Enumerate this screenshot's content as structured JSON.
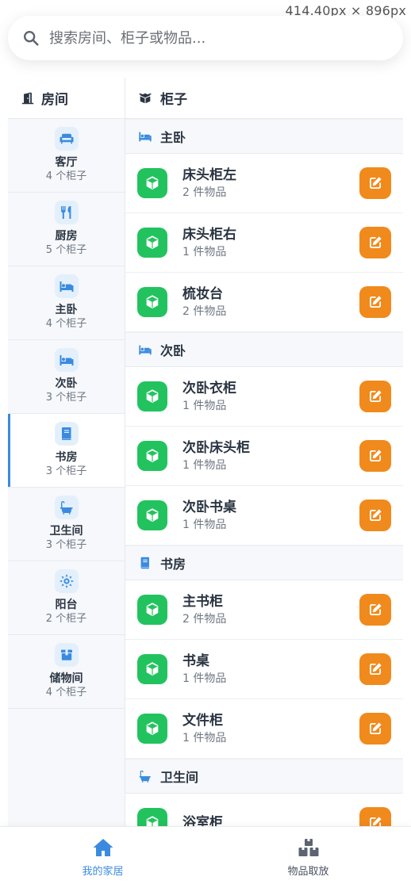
{
  "overlay": {
    "dimensions": "414.40px × 896px"
  },
  "search": {
    "placeholder": "搜索房间、柜子或物品..."
  },
  "sidebar": {
    "title": "房间",
    "rooms": [
      {
        "name": "客厅",
        "count": "4 个柜子",
        "icon": "sofa-icon"
      },
      {
        "name": "厨房",
        "count": "5 个柜子",
        "icon": "utensils-icon"
      },
      {
        "name": "主卧",
        "count": "4 个柜子",
        "icon": "bed-icon"
      },
      {
        "name": "次卧",
        "count": "3 个柜子",
        "icon": "bed-icon"
      },
      {
        "name": "书房",
        "count": "3 个柜子",
        "icon": "book-icon",
        "active": true
      },
      {
        "name": "卫生间",
        "count": "3 个柜子",
        "icon": "bath-icon"
      },
      {
        "name": "阳台",
        "count": "2 个柜子",
        "icon": "sun-icon"
      },
      {
        "name": "储物间",
        "count": "4 个柜子",
        "icon": "box-icon"
      }
    ]
  },
  "main": {
    "title": "柜子",
    "groups": [
      {
        "room": "主卧",
        "cabinets": [
          {
            "name": "床头柜左",
            "count": "2 件物品"
          },
          {
            "name": "床头柜右",
            "count": "1 件物品"
          },
          {
            "name": "梳妆台",
            "count": "2 件物品"
          }
        ]
      },
      {
        "room": "次卧",
        "cabinets": [
          {
            "name": "次卧衣柜",
            "count": "1 件物品"
          },
          {
            "name": "次卧床头柜",
            "count": "1 件物品"
          },
          {
            "name": "次卧书桌",
            "count": "1 件物品"
          }
        ]
      },
      {
        "room": "书房",
        "cabinets": [
          {
            "name": "主书柜",
            "count": "2 件物品"
          },
          {
            "name": "书桌",
            "count": "1 件物品"
          },
          {
            "name": "文件柜",
            "count": "1 件物品"
          }
        ]
      },
      {
        "room": "卫生间",
        "cabinets": [
          {
            "name": "浴室柜",
            "count": ""
          }
        ]
      }
    ]
  },
  "bottom_nav": {
    "home_label": "我的家居",
    "items_label": "物品取放"
  },
  "colors": {
    "accent": "#3a8be0",
    "cabinet_green": "#22c35e",
    "edit_orange": "#f08a1c"
  }
}
